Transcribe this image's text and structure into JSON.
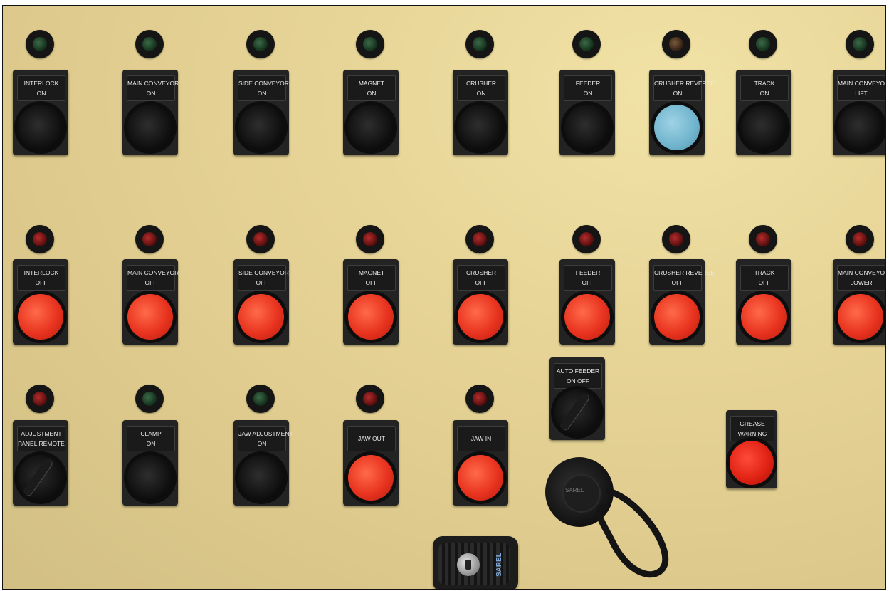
{
  "panel": {
    "row1": [
      {
        "line1": "INTERLOCK",
        "line2": "ON",
        "lamp": "green",
        "button": "black"
      },
      {
        "line1": "MAIN CONVEYOR",
        "line2": "ON",
        "lamp": "green",
        "button": "black"
      },
      {
        "line1": "SIDE CONVEYOR",
        "line2": "ON",
        "lamp": "green",
        "button": "black"
      },
      {
        "line1": "MAGNET",
        "line2": "ON",
        "lamp": "green",
        "button": "black"
      },
      {
        "line1": "CRUSHER",
        "line2": "ON",
        "lamp": "green",
        "button": "black"
      },
      {
        "line1": "FEEDER",
        "line2": "ON",
        "lamp": "green",
        "button": "black"
      },
      {
        "line1": "CRUSHER REVERSE",
        "line2": "ON",
        "lamp": "amber",
        "button": "blue"
      },
      {
        "line1": "TRACK",
        "line2": "ON",
        "lamp": "green",
        "button": "black"
      },
      {
        "line1": "MAIN CONVEYOR",
        "line2": "LIFT",
        "lamp": "green",
        "button": "black"
      }
    ],
    "row2": [
      {
        "line1": "INTERLOCK",
        "line2": "OFF",
        "lamp": "red",
        "button": "red"
      },
      {
        "line1": "MAIN CONVEYOR",
        "line2": "OFF",
        "lamp": "red",
        "button": "red"
      },
      {
        "line1": "SIDE CONVEYOR",
        "line2": "OFF",
        "lamp": "red",
        "button": "red"
      },
      {
        "line1": "MAGNET",
        "line2": "OFF",
        "lamp": "red",
        "button": "red"
      },
      {
        "line1": "CRUSHER",
        "line2": "OFF",
        "lamp": "red",
        "button": "red"
      },
      {
        "line1": "FEEDER",
        "line2": "OFF",
        "lamp": "red",
        "button": "red"
      },
      {
        "line1": "CRUSHER REVERSE",
        "line2": "OFF",
        "lamp": "red",
        "button": "red"
      },
      {
        "line1": "TRACK",
        "line2": "OFF",
        "lamp": "red",
        "button": "red"
      },
      {
        "line1": "MAIN CONVEYOR",
        "line2": "LOWER",
        "lamp": "red",
        "button": "red"
      }
    ],
    "row3": [
      {
        "line1": "ADJUSTMENT",
        "line2": "PANEL REMOTE",
        "lamp": "red",
        "button": "selector"
      },
      {
        "line1": "CLAMP",
        "line2": "ON",
        "lamp": "green",
        "button": "black"
      },
      {
        "line1": "JAW ADJUSTMENT",
        "line2": "ON",
        "lamp": "green",
        "button": "black"
      },
      {
        "line1": "JAW OUT",
        "line2": "",
        "lamp": "red",
        "button": "red"
      },
      {
        "line1": "JAW IN",
        "line2": "",
        "lamp": "red",
        "button": "red"
      }
    ],
    "auto_feeder": {
      "line1": "AUTO FEEDER",
      "line2": "ON    OFF"
    },
    "grease": {
      "line1": "GREASE",
      "line2": "WARNING"
    },
    "socket_brand": "SAREL",
    "keyswitch_brand": "SAREL",
    "colors": {
      "panel": "#e6d496",
      "red_cap": "#e8331f",
      "blue_cap": "#6fb4cc",
      "housing": "#232323"
    }
  }
}
